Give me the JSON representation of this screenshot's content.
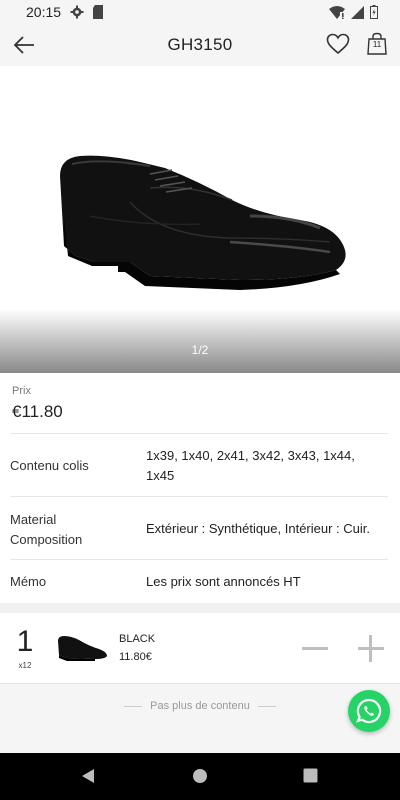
{
  "status_bar": {
    "time": "20:15",
    "icons_left": [
      "settings-icon",
      "sd-card-icon"
    ],
    "icons_right": [
      "wifi-icon",
      "signal-icon",
      "battery-icon"
    ]
  },
  "app_bar": {
    "title": "GH3150",
    "cart_count": "11",
    "icons": [
      "back-arrow-icon",
      "heart-icon",
      "shopping-bag-icon"
    ]
  },
  "gallery": {
    "indicator": "1/2"
  },
  "product": {
    "price_label": "Prix",
    "price": "€11.80",
    "specs": [
      {
        "label": "Contenu colis",
        "value": "1x39, 1x40, 2x41, 3x42, 3x43, 1x44, 1x45"
      },
      {
        "label": "Material Composition",
        "value": "Extérieur : Synthétique, Intérieur : Cuir."
      },
      {
        "label": "Mémo",
        "value": "Les prix sont annoncés HT"
      }
    ]
  },
  "variant": {
    "quantity": "1",
    "pack": "x12",
    "color": "BLACK",
    "price": "11.80€"
  },
  "footer": {
    "no_more": "Pas plus de contenu"
  },
  "colors": {
    "whatsapp": "#25d366",
    "app_bar_bg": "#f5f5f5"
  }
}
